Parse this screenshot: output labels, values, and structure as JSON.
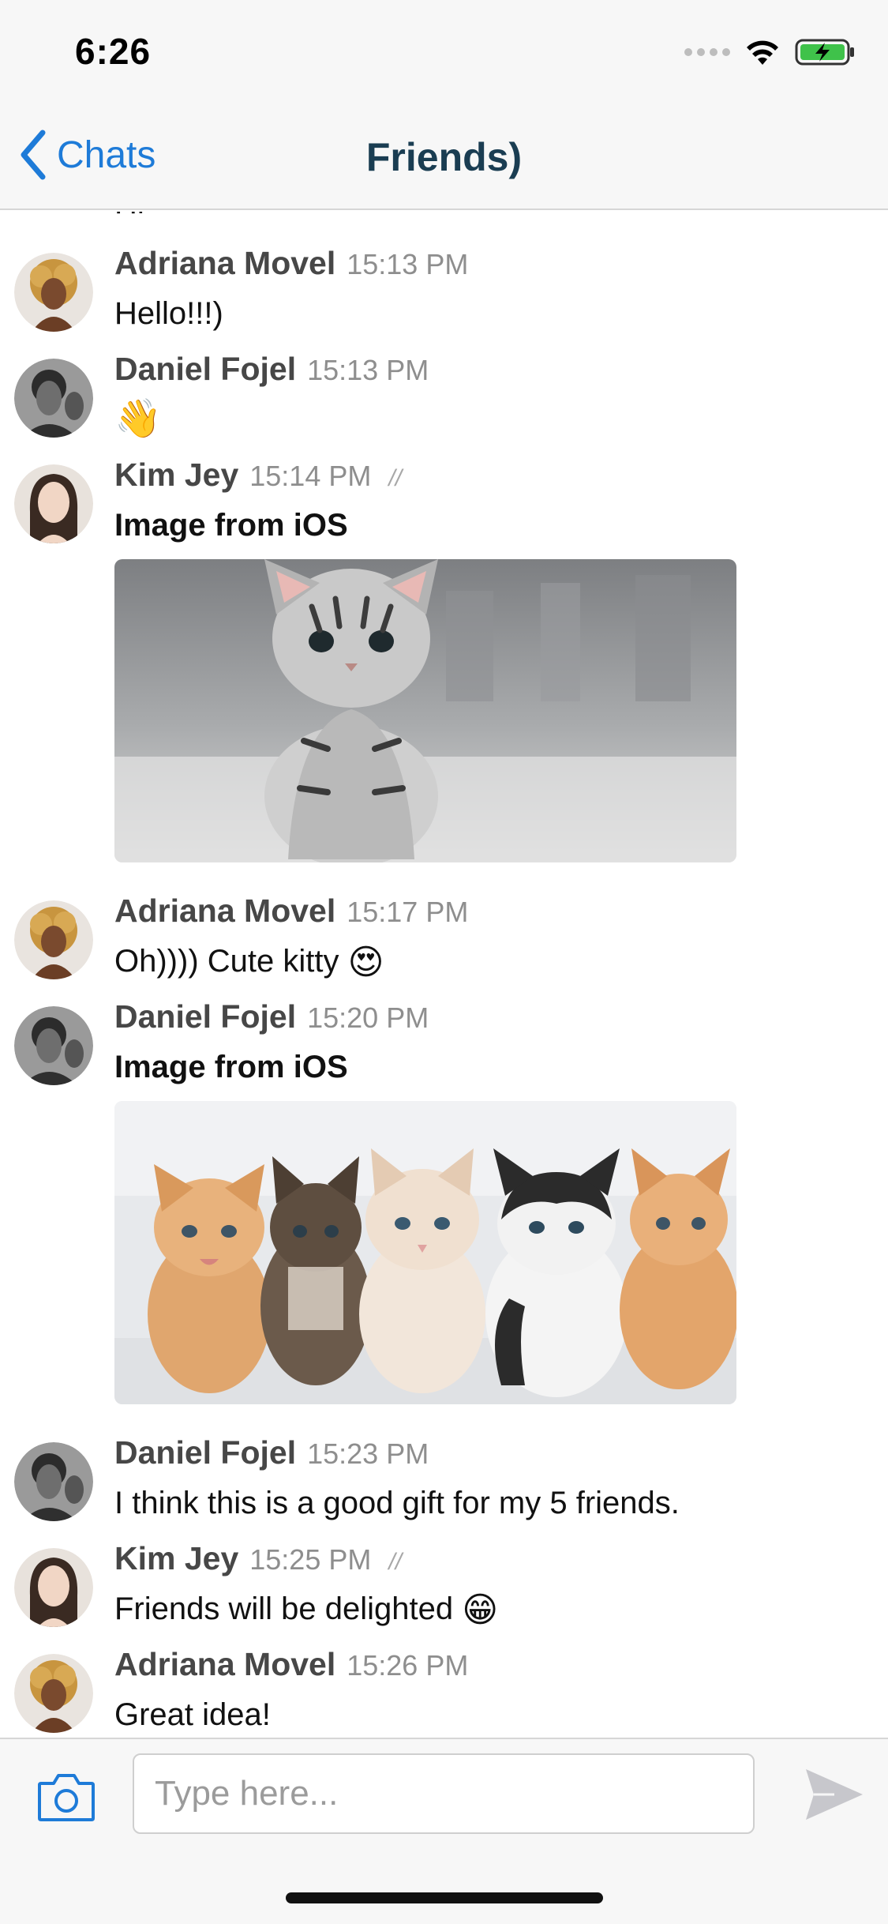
{
  "status_bar": {
    "time": "6:26"
  },
  "nav": {
    "back_label": "Chats",
    "title": "Friends)"
  },
  "messages": [
    {
      "sender": "Adriana Movel",
      "time": "15:13 PM",
      "text": "Hello!!!)"
    },
    {
      "sender": "Daniel Fojel",
      "time": "15:13 PM",
      "text": "👋"
    },
    {
      "sender": "Kim Jey",
      "time": "15:14 PM",
      "text": "Image from iOS",
      "read_mark": "//"
    },
    {
      "sender": "Adriana Movel",
      "time": "15:17 PM",
      "text": "Oh)))) Cute kitty",
      "emoji": "😍"
    },
    {
      "sender": "Daniel Fojel",
      "time": "15:20 PM",
      "text": "Image from iOS"
    },
    {
      "sender": "Daniel Fojel",
      "time": "15:23 PM",
      "text": "I think this is a good gift for my 5 friends."
    },
    {
      "sender": "Kim Jey",
      "time": "15:25 PM",
      "text": "Friends will be delighted",
      "emoji": "😁",
      "read_mark": "//"
    },
    {
      "sender": "Adriana Movel",
      "time": "15:26 PM",
      "text": "Great idea!"
    }
  ],
  "partial_top_text": "Hi",
  "input": {
    "placeholder": "Type here..."
  },
  "colors": {
    "accent": "#1e7bd8",
    "title": "#1a3d52",
    "sender": "#474747",
    "time": "#8e8e8e",
    "bar_bg": "#f7f7f7"
  },
  "icons": [
    "signal-icon",
    "wifi-icon",
    "battery-charging-icon",
    "chevron-left-icon",
    "camera-icon",
    "send-icon"
  ]
}
